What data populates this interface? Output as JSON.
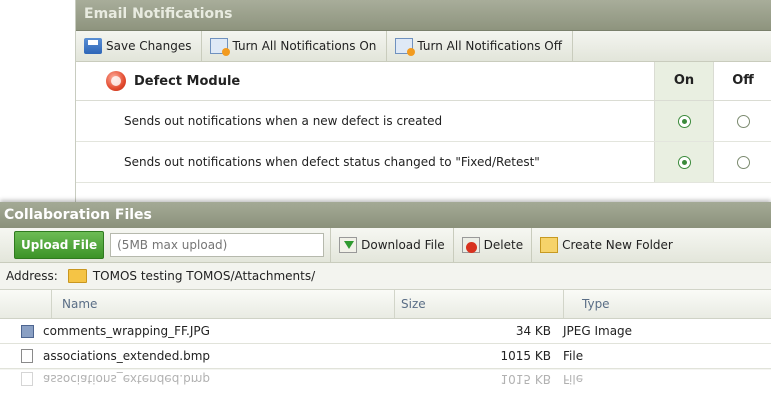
{
  "email": {
    "title": "Email Notifications",
    "toolbar": {
      "save": "Save Changes",
      "all_on": "Turn All Notifications On",
      "all_off": "Turn All Notifications Off"
    },
    "module": {
      "name": "Defect Module",
      "col_on": "On",
      "col_off": "Off"
    },
    "rows": [
      {
        "text": "Sends out notifications when a new defect is created",
        "on": true
      },
      {
        "text": "Sends out notifications when defect status changed to \"Fixed/Retest\"",
        "on": true
      }
    ]
  },
  "files": {
    "title": "Collaboration Files",
    "upload_label": "Upload File",
    "upload_placeholder": "(5MB max upload)",
    "download": "Download File",
    "delete": "Delete",
    "new_folder": "Create New Folder",
    "address_label": "Address:",
    "address_path": "TOMOS testing TOMOS/Attachments/",
    "columns": {
      "name": "Name",
      "size": "Size",
      "type": "Type"
    },
    "rows": [
      {
        "name": "comments_wrapping_FF.JPG",
        "size": "34 KB",
        "type": "JPEG Image",
        "icon": "image-file-icon"
      },
      {
        "name": "associations_extended.bmp",
        "size": "1015 KB",
        "type": "File",
        "icon": "file-icon"
      }
    ]
  },
  "colors": {
    "panel_header": "#9a9f8a",
    "on_column": "#e9efe1",
    "upload_green": "#4ea63a",
    "radio_checked": "#3b8a3b"
  }
}
